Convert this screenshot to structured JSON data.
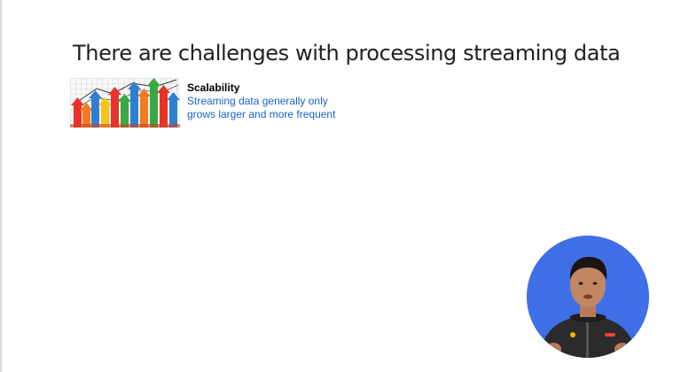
{
  "slide": {
    "title": "There are challenges with processing streaming data",
    "bullets": [
      {
        "heading": "Scalability",
        "body": "Streaming data generally only grows larger and more frequent",
        "image": "rising-bar-chart-arrows"
      }
    ]
  },
  "presenter": {
    "image": "presenter-video-circle"
  },
  "colors": {
    "title": "#202124",
    "heading": "#000000",
    "body": "#1a62c9",
    "presenter_background": "#3f6fe6"
  }
}
